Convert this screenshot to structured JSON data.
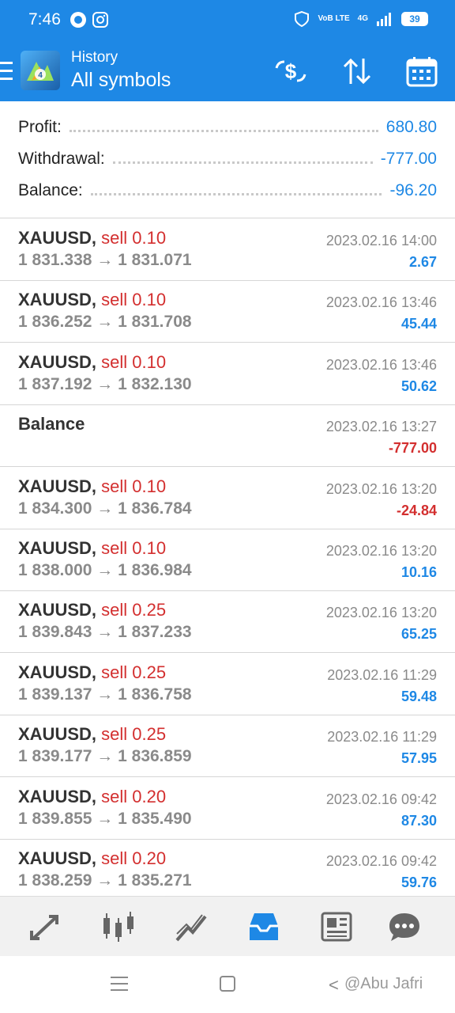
{
  "status_bar": {
    "time": "7:46",
    "network": "VoB LTE",
    "signal": "4G",
    "battery": "39"
  },
  "app_bar": {
    "title": "History",
    "subtitle": "All symbols",
    "icons": [
      "menu-icon",
      "metatrader-logo",
      "deposit-currency-icon",
      "sort-icon",
      "calendar-icon"
    ]
  },
  "summary": {
    "profit_label": "Profit:",
    "profit_value": "680.80",
    "withdrawal_label": "Withdrawal:",
    "withdrawal_value": "-777.00",
    "balance_label": "Balance:",
    "balance_value": "-96.20"
  },
  "deals": [
    {
      "symbol": "XAUUSD,",
      "side": "sell 0.10",
      "open": "1 831.338",
      "close": "1 831.071",
      "arrow": "→",
      "date": "2023.02.16 14:00",
      "pl": "2.67",
      "sign": "pos"
    },
    {
      "symbol": "XAUUSD,",
      "side": "sell 0.10",
      "open": "1 836.252",
      "close": "1 831.708",
      "arrow": "→",
      "date": "2023.02.16 13:46",
      "pl": "45.44",
      "sign": "pos"
    },
    {
      "symbol": "XAUUSD,",
      "side": "sell 0.10",
      "open": "1 837.192",
      "close": "1 832.130",
      "arrow": "→",
      "date": "2023.02.16 13:46",
      "pl": "50.62",
      "sign": "pos"
    },
    {
      "symbol": "Balance",
      "side": "",
      "open": "",
      "close": "",
      "arrow": "",
      "date": "2023.02.16 13:27",
      "pl": "-777.00",
      "sign": "neg"
    },
    {
      "symbol": "XAUUSD,",
      "side": "sell 0.10",
      "open": "1 834.300",
      "close": "1 836.784",
      "arrow": "→",
      "date": "2023.02.16 13:20",
      "pl": "-24.84",
      "sign": "neg"
    },
    {
      "symbol": "XAUUSD,",
      "side": "sell 0.10",
      "open": "1 838.000",
      "close": "1 836.984",
      "arrow": "→",
      "date": "2023.02.16 13:20",
      "pl": "10.16",
      "sign": "pos"
    },
    {
      "symbol": "XAUUSD,",
      "side": "sell 0.25",
      "open": "1 839.843",
      "close": "1 837.233",
      "arrow": "→",
      "date": "2023.02.16 13:20",
      "pl": "65.25",
      "sign": "pos"
    },
    {
      "symbol": "XAUUSD,",
      "side": "sell 0.25",
      "open": "1 839.137",
      "close": "1 836.758",
      "arrow": "→",
      "date": "2023.02.16 11:29",
      "pl": "59.48",
      "sign": "pos"
    },
    {
      "symbol": "XAUUSD,",
      "side": "sell 0.25",
      "open": "1 839.177",
      "close": "1 836.859",
      "arrow": "→",
      "date": "2023.02.16 11:29",
      "pl": "57.95",
      "sign": "pos"
    },
    {
      "symbol": "XAUUSD,",
      "side": "sell 0.20",
      "open": "1 839.855",
      "close": "1 835.490",
      "arrow": "→",
      "date": "2023.02.16 09:42",
      "pl": "87.30",
      "sign": "pos"
    },
    {
      "symbol": "XAUUSD,",
      "side": "sell 0.20",
      "open": "1 838.259",
      "close": "1 835.271",
      "arrow": "→",
      "date": "2023.02.16 09:42",
      "pl": "59.76",
      "sign": "pos"
    }
  ],
  "bottom_tabs": [
    "quotes-icon",
    "chart-icon",
    "trade-icon",
    "history-icon",
    "news-icon",
    "chat-icon"
  ],
  "active_tab": "history-icon",
  "watermark": "@Abu Jafri",
  "colors": {
    "accent": "#1e88e5",
    "loss": "#d32f2f",
    "muted": "#8a8a8a"
  }
}
